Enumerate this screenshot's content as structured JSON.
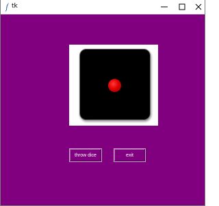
{
  "window": {
    "title": "tk",
    "controls": {
      "minimize_icon": "minimize-icon",
      "maximize_icon": "maximize-icon",
      "close_icon": "close-icon"
    }
  },
  "colors": {
    "background": "#800080",
    "dice_face": "#000000",
    "pip": "#e00000",
    "frame": "#ffffff"
  },
  "dice": {
    "value": 1
  },
  "buttons": {
    "throw_label": "throw dice",
    "exit_label": "exit"
  }
}
